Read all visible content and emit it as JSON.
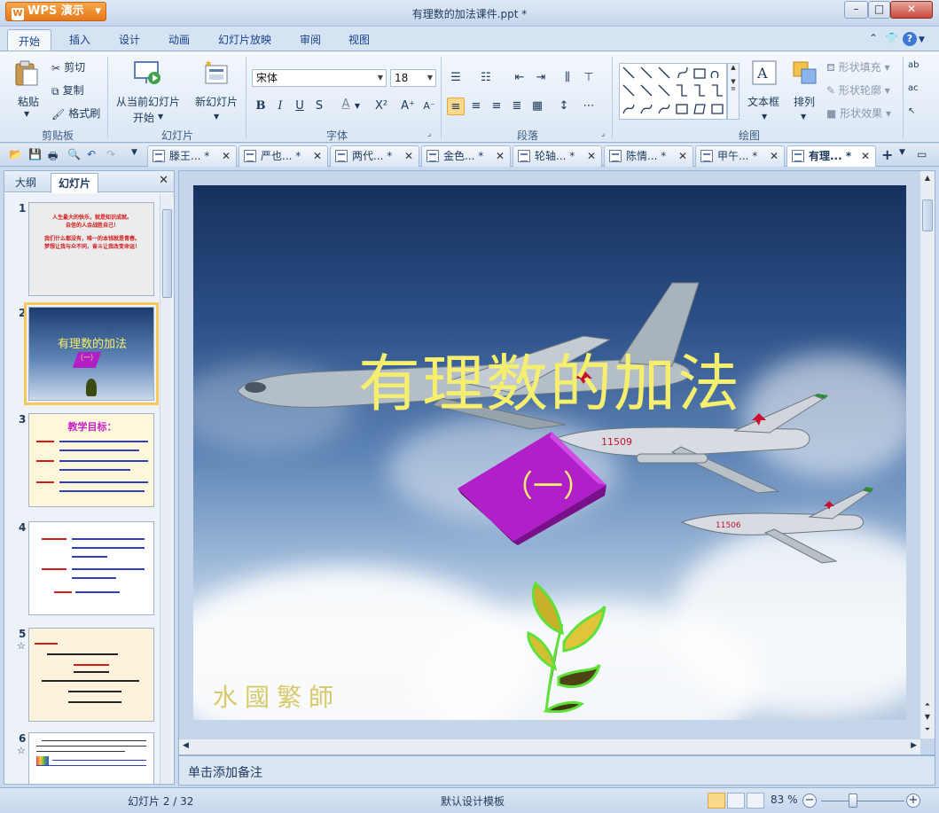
{
  "app": {
    "name": "WPS 演示",
    "window_title": "有理数的加法课件.ppt *"
  },
  "ribbon_tabs": [
    "开始",
    "插入",
    "设计",
    "动画",
    "幻灯片放映",
    "审阅",
    "视图"
  ],
  "clipboard": {
    "paste": "粘贴",
    "cut": "剪切",
    "copy": "复制",
    "format_painter": "格式刷",
    "group_label": "剪贴板"
  },
  "slides_group": {
    "play_from_current_line1": "从当前幻灯片",
    "play_from_current_line2": "开始",
    "new_slide": "新幻灯片",
    "group_label": "幻灯片"
  },
  "font_group": {
    "font_name": "宋体",
    "font_size": "18",
    "bold": "B",
    "italic": "I",
    "underline": "U",
    "shadow": "S",
    "font_color": "A",
    "superscript": "X²",
    "grow": "A⁺",
    "shrink": "A⁻",
    "group_label": "字体"
  },
  "paragraph_group": {
    "group_label": "段落"
  },
  "drawing_group": {
    "textbox": "文本框",
    "arrange": "排列",
    "shape_fill": "形状填充",
    "shape_outline": "形状轮廓",
    "shape_effect": "形状效果",
    "group_label": "绘图"
  },
  "doc_tabs": [
    {
      "label": "滕王... *",
      "active": false
    },
    {
      "label": "严也... *",
      "active": false
    },
    {
      "label": "两代... *",
      "active": false
    },
    {
      "label": "金色... *",
      "active": false
    },
    {
      "label": "轮轴... *",
      "active": false
    },
    {
      "label": "陈情... *",
      "active": false
    },
    {
      "label": "甲午... *",
      "active": false
    },
    {
      "label": "有理... *",
      "active": true
    }
  ],
  "left_panel": {
    "tab_outline": "大纲",
    "tab_slides": "幻灯片",
    "slides": [
      {
        "num": "1",
        "lines": [
          "人生最大的快乐，就是知识成就。",
          "自信的人会战胜自己！",
          "我们什么都没有，唯一的本钱就是青春。",
          "梦想让我与众不同，奋斗让我改变命运！"
        ]
      },
      {
        "num": "2",
        "title": "有理数的加法",
        "sub": "（一）"
      },
      {
        "num": "3",
        "heading": "教学目标："
      },
      {
        "num": "4"
      },
      {
        "num": "5",
        "star": "☆"
      },
      {
        "num": "6",
        "star": "☆"
      }
    ]
  },
  "slide": {
    "title": "有理数的加法",
    "subtitle": "（一）",
    "signature": "水國繁師"
  },
  "notes_placeholder": "单击添加备注",
  "status": {
    "slide_counter": "幻灯片 2 / 32",
    "template": "默认设计模板",
    "zoom": "83 %"
  }
}
